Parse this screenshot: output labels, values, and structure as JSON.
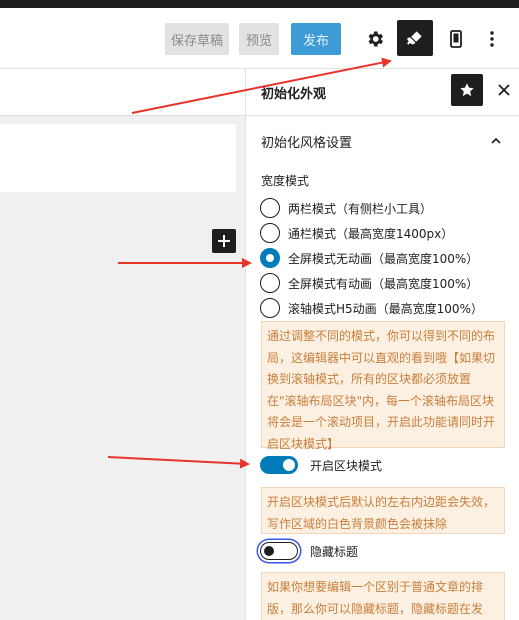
{
  "toolbar": {
    "save_draft": "保存草稿",
    "preview": "预览",
    "publish": "发布"
  },
  "sidebar": {
    "title": "初始化外观",
    "panel_title": "初始化风格设置",
    "width_mode_label": "宽度模式",
    "radio_options": [
      {
        "label": "两栏模式（有侧栏小工具）",
        "checked": false
      },
      {
        "label": "通栏模式（最高宽度1400px）",
        "checked": false
      },
      {
        "label": "全屏模式无动画（最高宽度100%）",
        "checked": true
      },
      {
        "label": "全屏模式有动画（最高宽度100%）",
        "checked": false
      },
      {
        "label": "滚轴模式H5动画（最高宽度100%）",
        "checked": false
      }
    ],
    "notice1": "通过调整不同的模式，你可以得到不同的布局，这编辑器中可以直观的看到哦【如果切换到滚轴模式，所有的区块都必须放置在\"滚轴布局区块\"内，每一个滚轴布局区块将会是一个滚动项目，开启此功能请同时开启区块模式】",
    "block_mode_toggle": {
      "label": "开启区块模式",
      "on": true
    },
    "notice2": "开启区块模式后默认的左右内边距会失效，写作区域的白色背景颜色会被抹除",
    "hide_title_toggle": {
      "label": "隐藏标题",
      "on": false
    },
    "notice3": "如果你想要编辑一个区别于普通文章的排版，那么你可以隐藏标题，隐藏标题在发"
  },
  "icons": {
    "settings": "gear-icon",
    "appearance": "brush-icon",
    "device": "mobile-icon",
    "more": "more-vertical-icon",
    "pin": "star-icon",
    "close": "close-icon",
    "collapse": "chevron-up-icon",
    "add_block": "plus-icon"
  },
  "colors": {
    "accent": "#007cba",
    "publish": "#3d9bd6",
    "notice_bg": "#fcf0e3",
    "notice_text": "#c87f3a",
    "annotation_arrow": "#e8332a"
  }
}
